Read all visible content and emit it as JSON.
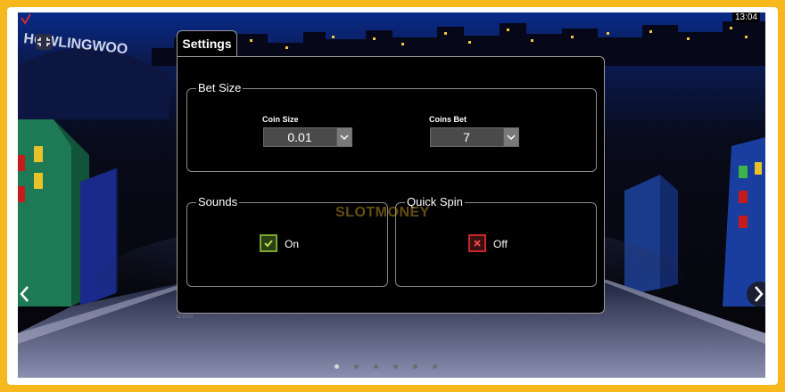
{
  "clock": "13:04",
  "logo_text": "HOWLINGWOO",
  "settings_tab": "Settings",
  "bet_size": {
    "title": "Bet Size",
    "coin_size_label": "Coin Size",
    "coin_size_value": "0.01",
    "coins_bet_label": "Coins Bet",
    "coins_bet_value": "7"
  },
  "sounds": {
    "title": "Sounds",
    "state": "On"
  },
  "quick_spin": {
    "title": "Quick Spin",
    "state": "Off"
  },
  "version": "v1.0.0.0",
  "watermark": "SLOTMONEY",
  "pagination": {
    "total": 6,
    "active": 1
  },
  "colors": {
    "frame": "#f6b81c",
    "check_on": "#7aa832",
    "check_off": "#c9272a"
  }
}
